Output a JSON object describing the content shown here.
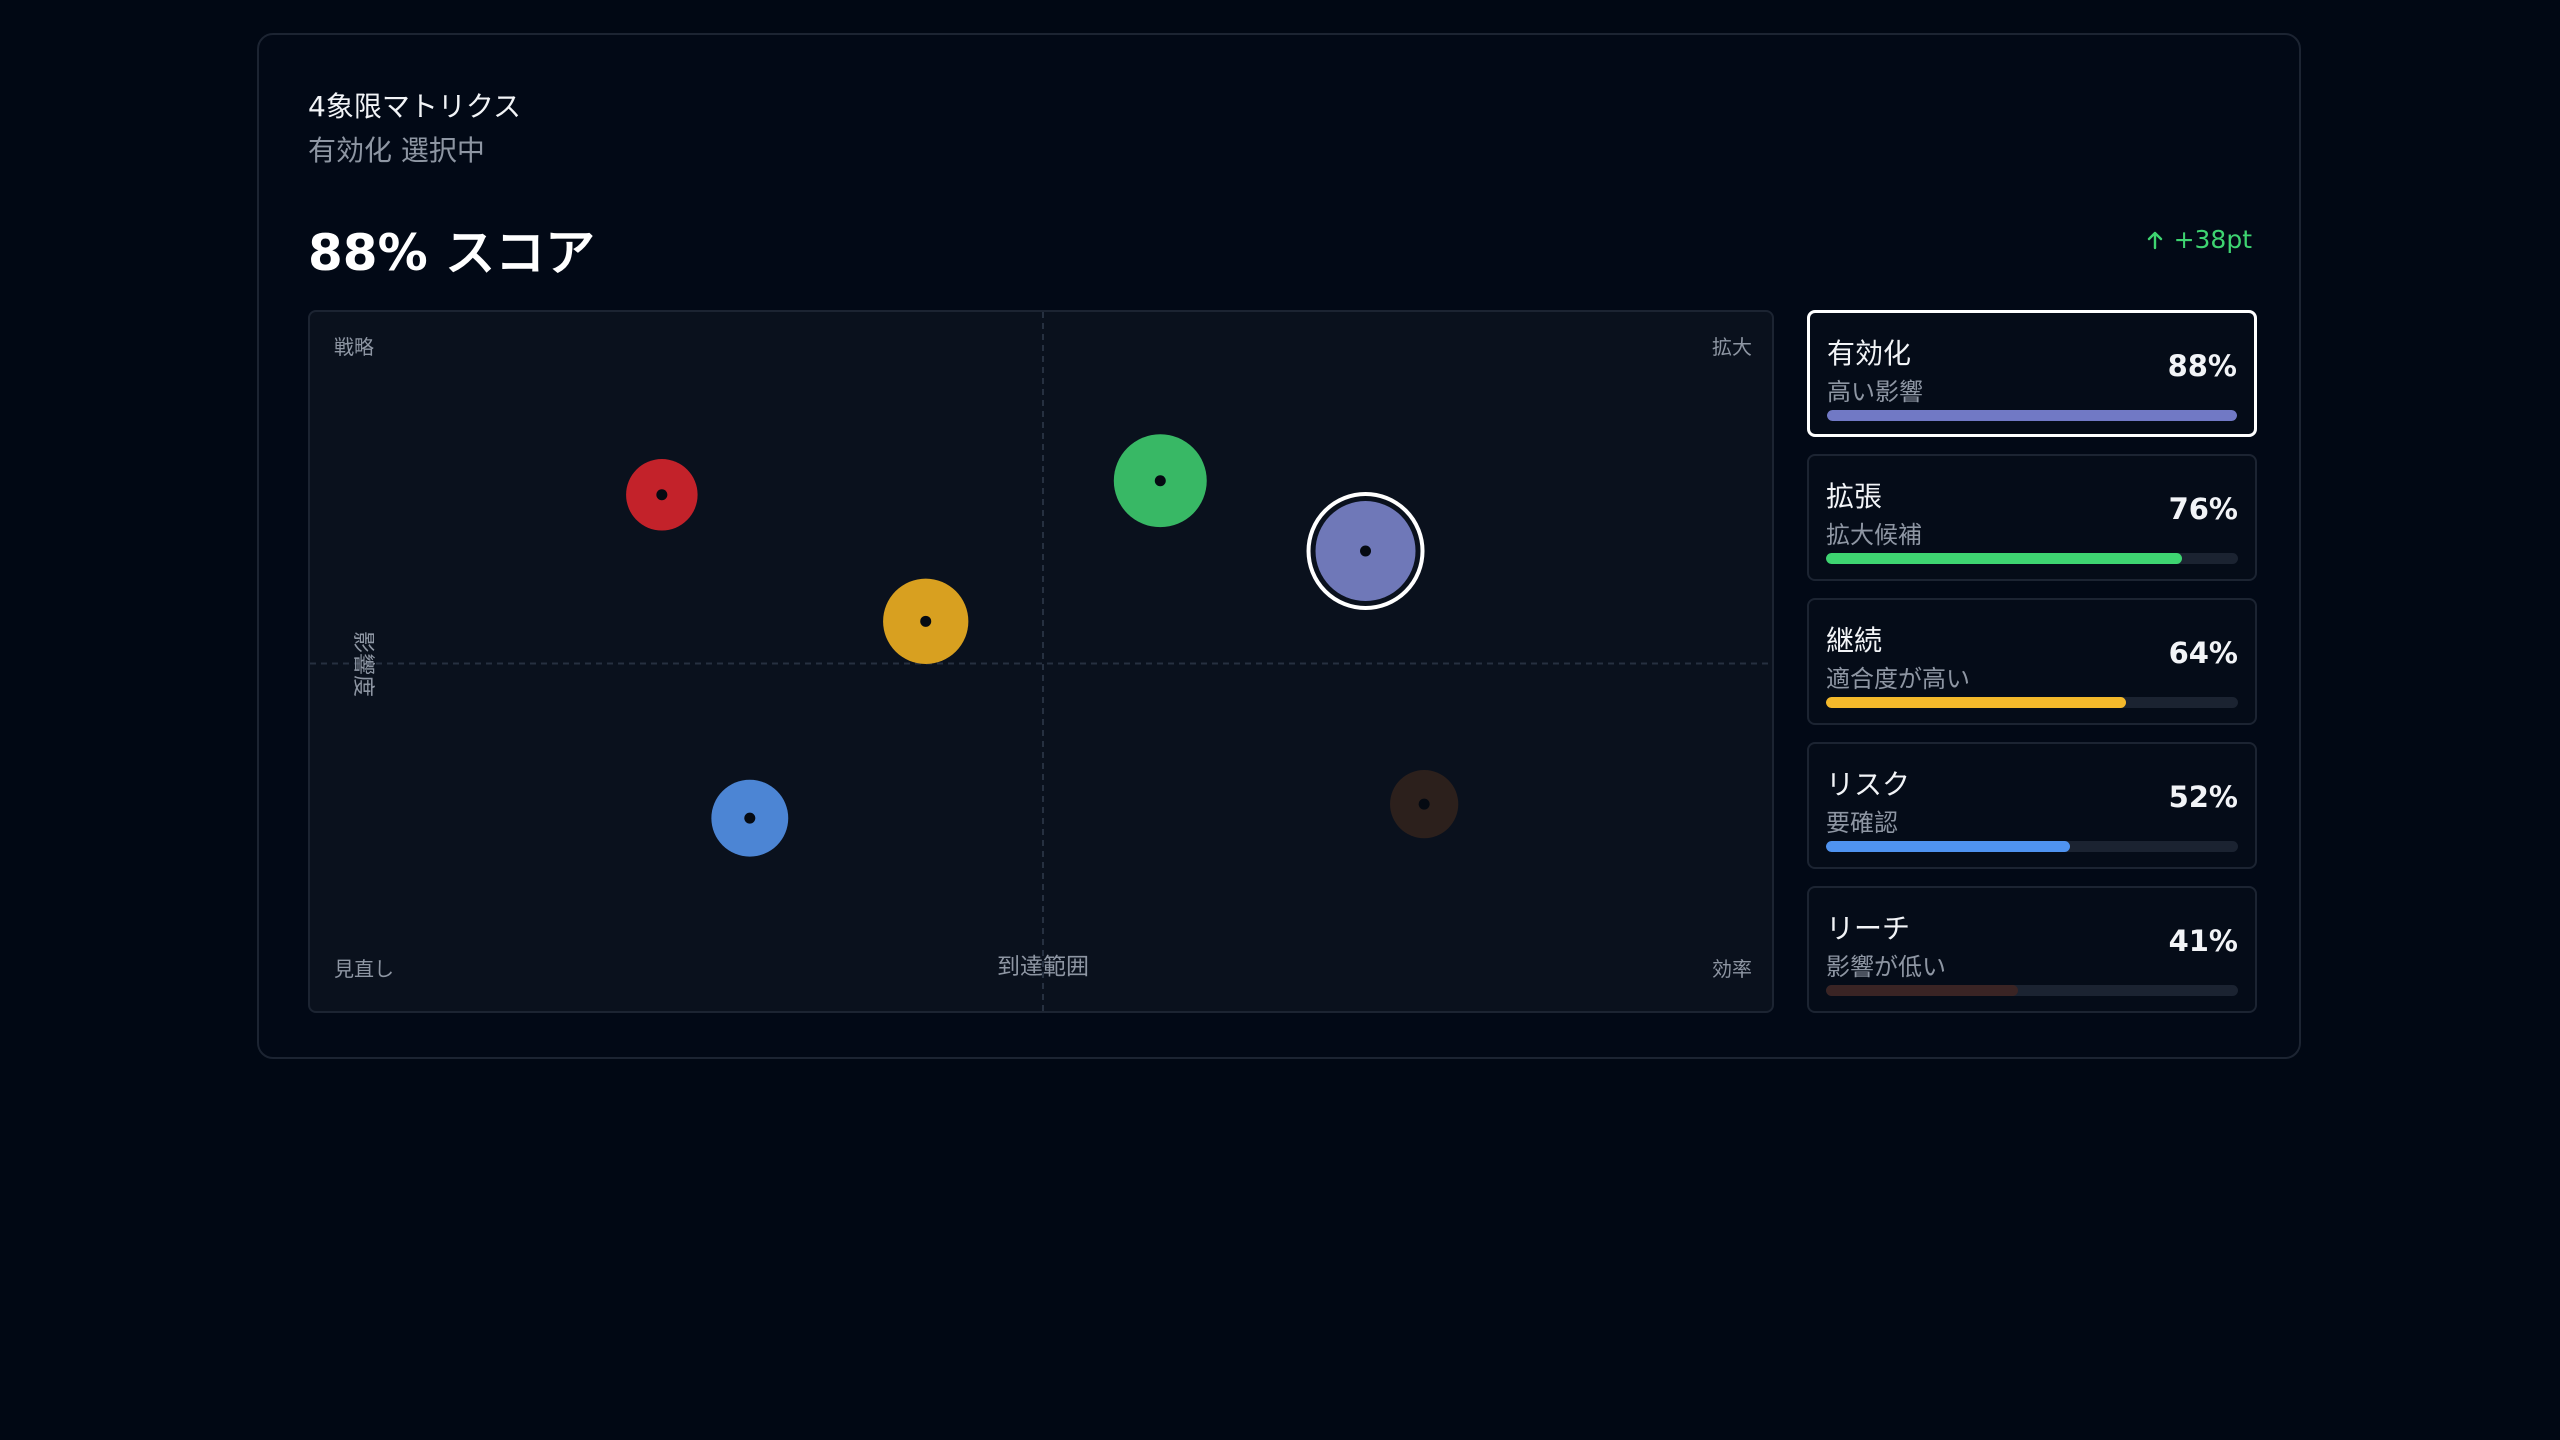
{
  "header": {
    "eyebrow": "4象限マトリクス",
    "selection": "有効化 選択中",
    "headline": "88% スコア",
    "delta": "+38pt",
    "delta_icon": "arrow-up-icon",
    "delta_color": "#3ed471"
  },
  "chart_data": {
    "type": "scatter",
    "xlabel": "到達範囲",
    "ylabel": "影響度",
    "xlim": [
      0,
      100
    ],
    "ylim": [
      0,
      100
    ],
    "grid": false,
    "quadrant_labels": {
      "top_left": "戦略",
      "top_right": "拡大",
      "bottom_left": "見直し",
      "bottom_right": "効率"
    },
    "points": [
      {
        "label": "有効化",
        "x": 72,
        "y": 66,
        "size": 88,
        "color": "#6f78b8",
        "selected": true
      },
      {
        "label": "拡張",
        "x": 58,
        "y": 76,
        "size": 76,
        "color": "#38b865"
      },
      {
        "label": "継続",
        "x": 42,
        "y": 56,
        "size": 64,
        "color": "#d8a020"
      },
      {
        "label": "リスク",
        "x": 30,
        "y": 28,
        "size": 52,
        "color": "#4c85d4"
      },
      {
        "label": "リーチ",
        "x": 76,
        "y": 30,
        "size": 41,
        "color": "#2c201c"
      },
      {
        "label": "",
        "x": 24,
        "y": 74,
        "size": 45,
        "color": "#c3222a"
      }
    ]
  },
  "items": [
    {
      "title": "有効化",
      "subtitle": "高い影響",
      "percent": "88%",
      "value": 100,
      "color": "#7179c5",
      "selected": true
    },
    {
      "title": "拡張",
      "subtitle": "拡大候補",
      "percent": "76%",
      "value": 86.5,
      "color": "#3ed471",
      "selected": false
    },
    {
      "title": "継続",
      "subtitle": "適合度が高い",
      "percent": "64%",
      "value": 72.8,
      "color": "#f4b92b",
      "selected": false
    },
    {
      "title": "リスク",
      "subtitle": "要確認",
      "percent": "52%",
      "value": 59.2,
      "color": "#4f93f0",
      "selected": false
    },
    {
      "title": "リーチ",
      "subtitle": "影響が低い",
      "percent": "41%",
      "value": 46.6,
      "color": "#3a2424",
      "selected": false
    }
  ]
}
